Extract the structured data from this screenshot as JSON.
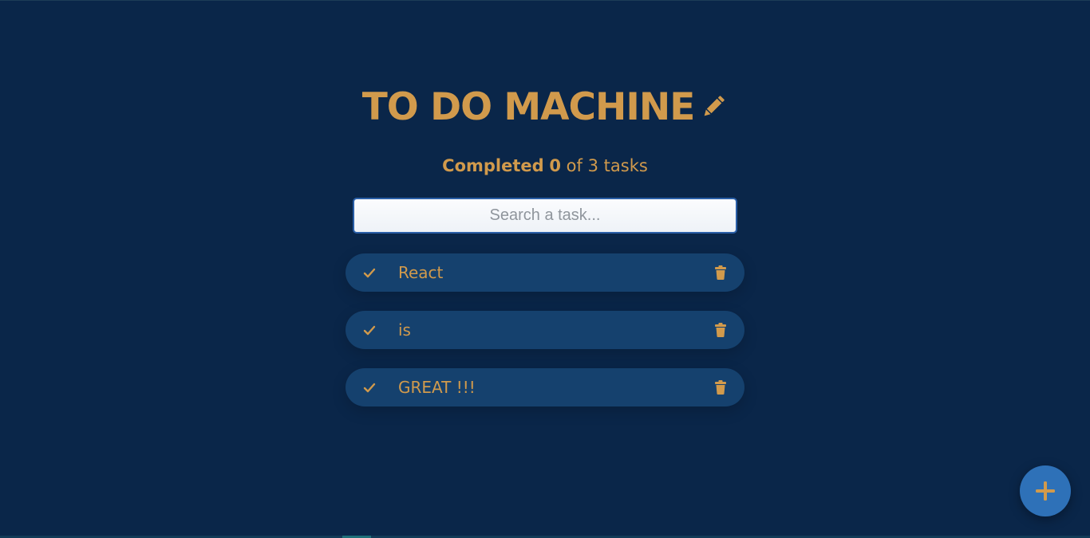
{
  "app": {
    "title": "TO DO MACHINE",
    "title_icon": "pencil-icon"
  },
  "counter": {
    "completed_label": "Completed",
    "completed_count": "0",
    "of_label": "of",
    "total_count": "3",
    "tasks_label": "tasks"
  },
  "search": {
    "placeholder": "Search a task...",
    "value": ""
  },
  "tasks": [
    {
      "text": "React",
      "completed": false,
      "check_icon": "check-icon",
      "delete_icon": "trash-icon"
    },
    {
      "text": "is",
      "completed": false,
      "check_icon": "check-icon",
      "delete_icon": "trash-icon"
    },
    {
      "text": "GREAT !!!",
      "completed": false,
      "check_icon": "check-icon",
      "delete_icon": "trash-icon"
    }
  ],
  "fab": {
    "icon": "plus-icon"
  },
  "colors": {
    "background": "#0a2649",
    "accent": "#d19a4c",
    "task_background": "#15416e",
    "fab_background": "#2e71b8",
    "search_border": "#2a5fa8"
  }
}
